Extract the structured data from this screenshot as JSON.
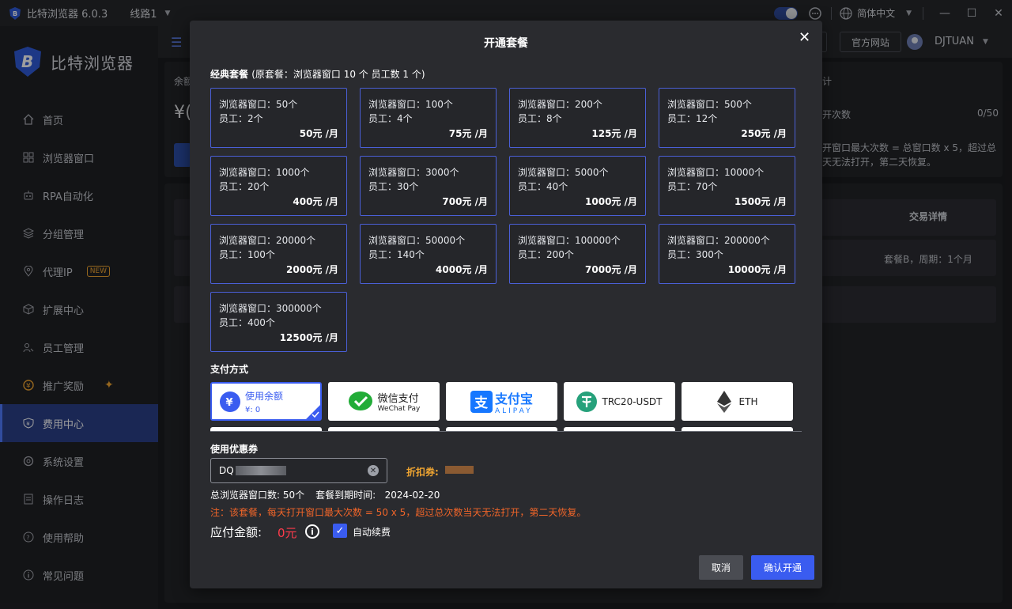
{
  "titlebar": {
    "app_name": "比特浏览器 6.0.3",
    "line_label": "线路1",
    "language": "简体中文"
  },
  "sidebar": {
    "brand": "比特浏览器",
    "items": [
      {
        "label": "首页",
        "icon": "home-icon"
      },
      {
        "label": "浏览器窗口",
        "icon": "grid-icon"
      },
      {
        "label": "RPA自动化",
        "icon": "robot-icon"
      },
      {
        "label": "分组管理",
        "icon": "group-icon"
      },
      {
        "label": "代理IP",
        "icon": "location-icon",
        "badge": "NEW"
      },
      {
        "label": "扩展中心",
        "icon": "cube-icon"
      },
      {
        "label": "员工管理",
        "icon": "users-icon"
      },
      {
        "label": "推广奖励",
        "icon": "reward-icon"
      },
      {
        "label": "费用中心",
        "icon": "shield-yen-icon",
        "active": true
      },
      {
        "label": "系统设置",
        "icon": "gear-icon"
      },
      {
        "label": "操作日志",
        "icon": "log-icon"
      },
      {
        "label": "使用帮助",
        "icon": "help-icon"
      },
      {
        "label": "常见问题",
        "icon": "info-icon"
      }
    ]
  },
  "header": {
    "official_site": "官方网站",
    "username": "DJTUAN"
  },
  "background": {
    "balance_label": "余额",
    "yen_text": "¥(",
    "stat_suffix": "计",
    "open_count_label": "开次数",
    "open_count_value": "0/50",
    "note_line1": "开窗口最大次数 = 总窗口数 x 5，超过总",
    "note_line2": "天无法打开，第二天恢复。",
    "col_detail": "交易详情",
    "row_detail": "套餐B，周期：1个月"
  },
  "modal": {
    "title": "开通套餐",
    "section_plans": "经典套餐",
    "section_plans_sub": "(原套餐：浏览器窗口 10 个 员工数 1 个)",
    "plans": [
      {
        "windows": "浏览器窗口：50个",
        "staff": "员工：2个",
        "price": "50元 /月"
      },
      {
        "windows": "浏览器窗口：100个",
        "staff": "员工：4个",
        "price": "75元 /月"
      },
      {
        "windows": "浏览器窗口：200个",
        "staff": "员工：8个",
        "price": "125元 /月"
      },
      {
        "windows": "浏览器窗口：500个",
        "staff": "员工：12个",
        "price": "250元 /月"
      },
      {
        "windows": "浏览器窗口：1000个",
        "staff": "员工：20个",
        "price": "400元 /月"
      },
      {
        "windows": "浏览器窗口：3000个",
        "staff": "员工：30个",
        "price": "700元 /月"
      },
      {
        "windows": "浏览器窗口：5000个",
        "staff": "员工：40个",
        "price": "1000元 /月"
      },
      {
        "windows": "浏览器窗口：10000个",
        "staff": "员工：70个",
        "price": "1500元 /月"
      },
      {
        "windows": "浏览器窗口：20000个",
        "staff": "员工：100个",
        "price": "2000元 /月"
      },
      {
        "windows": "浏览器窗口：50000个",
        "staff": "员工：140个",
        "price": "4000元 /月"
      },
      {
        "windows": "浏览器窗口：100000个",
        "staff": "员工：200个",
        "price": "7000元 /月"
      },
      {
        "windows": "浏览器窗口：200000个",
        "staff": "员工：300个",
        "price": "10000元 /月"
      },
      {
        "windows": "浏览器窗口：300000个",
        "staff": "员工：400个",
        "price": "12500元 /月"
      }
    ],
    "section_payment": "支付方式",
    "payments": {
      "balance_label": "使用余额",
      "balance_value": "¥: 0",
      "wechat_main": "微信支付",
      "wechat_sub": "WeChat Pay",
      "alipay_main": "支付宝",
      "alipay_sub": "ALIPAY",
      "usdt": "TRC20-USDT",
      "eth": "ETH"
    },
    "section_coupon": "使用优惠券",
    "coupon_prefix": "DQ",
    "discount_label": "折扣券:",
    "total_windows": "总浏览器窗口数: 50个",
    "expire": "套餐到期时间:   2024-02-20",
    "note": "注：该套餐，每天打开窗口最大次数 = 50 x 5，超过总次数当天无法打开，第二天恢复。",
    "amount_label": "应付金额:",
    "amount_value": "0元",
    "auto_renew": "自动续费",
    "cancel": "取消",
    "confirm": "确认开通"
  },
  "colors": {
    "accent": "#3a5cf0",
    "warning": "#f06529",
    "price_red": "#ff3b4b",
    "gold": "#f0a531"
  }
}
